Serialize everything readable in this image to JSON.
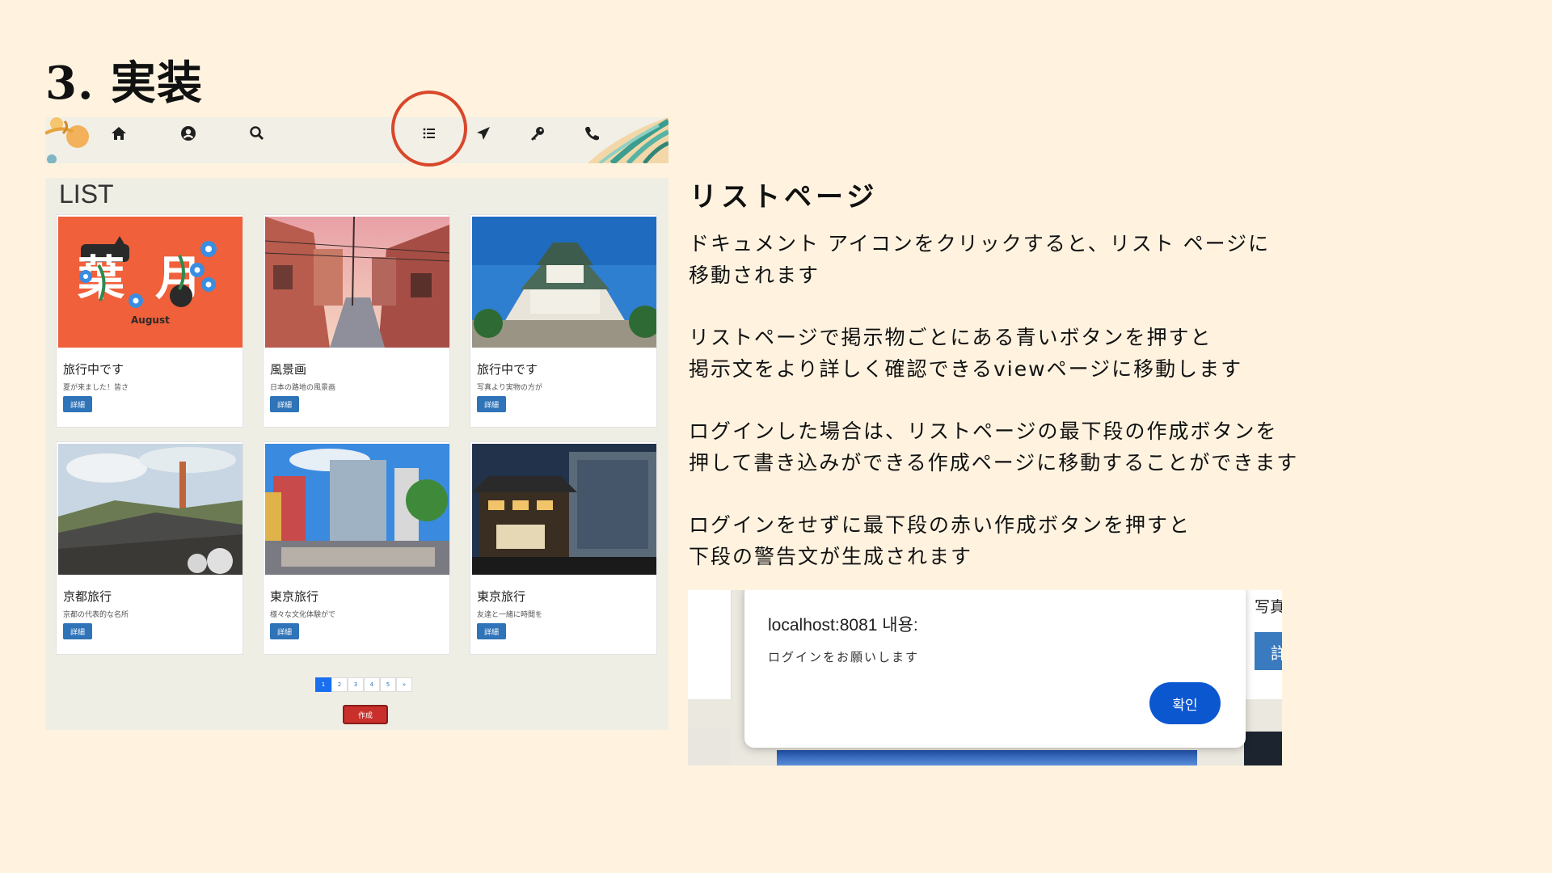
{
  "slide": {
    "title": "3. 実装"
  },
  "navbar": {
    "icons": [
      "home-icon",
      "user-icon",
      "search-icon",
      "list-icon",
      "send-icon",
      "key-icon",
      "phone-icon"
    ]
  },
  "list_page": {
    "heading": "LIST",
    "cards": [
      {
        "title": "旅行中です",
        "desc": "夏が来ました！皆さ",
        "button": "詳細",
        "image_text": "August"
      },
      {
        "title": "風景画",
        "desc": "日本の路地の風景画",
        "button": "詳細"
      },
      {
        "title": "旅行中です",
        "desc": "写真より実物の方が",
        "button": "詳細"
      },
      {
        "title": "京都旅行",
        "desc": "京都の代表的な名所",
        "button": "詳細"
      },
      {
        "title": "東京旅行",
        "desc": "様々な文化体験がで",
        "button": "詳細"
      },
      {
        "title": "東京旅行",
        "desc": "友達と一緒に時間を",
        "button": "詳細"
      }
    ],
    "pagination": [
      "1",
      "2",
      "3",
      "4",
      "5",
      "»"
    ],
    "active_page": "1",
    "create_button": "作成"
  },
  "section": {
    "title": "リストページ",
    "para1": [
      "ドキュメント アイコンをクリックすると、リスト ページに",
      "移動されます"
    ],
    "para2": [
      "リストページで掲示物ごとにある青いボタンを押すと",
      "掲示文をより詳しく確認できるviewページに移動します"
    ],
    "para3": [
      "ログインした場合は、リストページの最下段の作成ボタンを",
      "押して書き込みができる作成ページに移動することができます"
    ],
    "para4": [
      "ログインをせずに最下段の赤い作成ボタンを押すと",
      "下段の警告文が生成されます"
    ]
  },
  "dialog_shot": {
    "title": "localhost:8081 내용:",
    "message": "ログインをお願いします",
    "ok_button": "확인",
    "bg_text": "写真",
    "bg_button": "詳"
  },
  "colors": {
    "background": "#fff3e0",
    "highlight_circle": "#d9472b",
    "detail_button": "#2f73b8",
    "create_button": "#c9302c",
    "dialog_ok": "#0b57d0"
  }
}
